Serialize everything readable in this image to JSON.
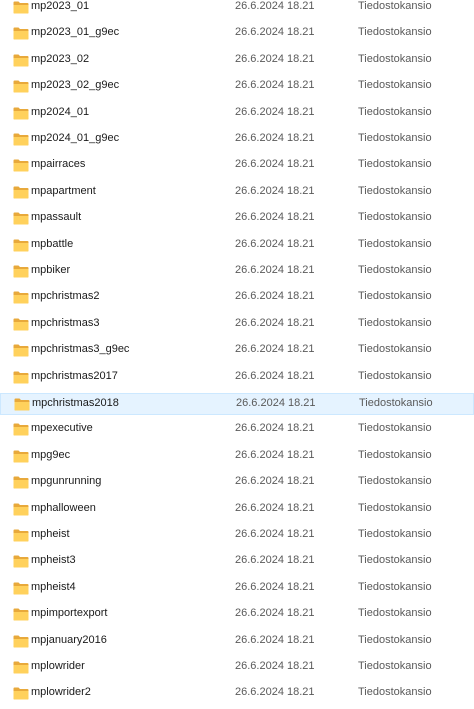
{
  "icons": {
    "folder": "folder-icon"
  },
  "colors": {
    "folder_back": "#e8a93b",
    "folder_front": "#ffd15c",
    "selection_bg": "#e5f3ff",
    "selection_border": "#cce8ff"
  },
  "files": [
    {
      "name": "mp2023_01",
      "modified": "26.6.2024 18.21",
      "type": "Tiedostokansio"
    },
    {
      "name": "mp2023_01_g9ec",
      "modified": "26.6.2024 18.21",
      "type": "Tiedostokansio"
    },
    {
      "name": "mp2023_02",
      "modified": "26.6.2024 18.21",
      "type": "Tiedostokansio"
    },
    {
      "name": "mp2023_02_g9ec",
      "modified": "26.6.2024 18.21",
      "type": "Tiedostokansio"
    },
    {
      "name": "mp2024_01",
      "modified": "26.6.2024 18.21",
      "type": "Tiedostokansio"
    },
    {
      "name": "mp2024_01_g9ec",
      "modified": "26.6.2024 18.21",
      "type": "Tiedostokansio"
    },
    {
      "name": "mpairraces",
      "modified": "26.6.2024 18.21",
      "type": "Tiedostokansio"
    },
    {
      "name": "mpapartment",
      "modified": "26.6.2024 18.21",
      "type": "Tiedostokansio"
    },
    {
      "name": "mpassault",
      "modified": "26.6.2024 18.21",
      "type": "Tiedostokansio"
    },
    {
      "name": "mpbattle",
      "modified": "26.6.2024 18.21",
      "type": "Tiedostokansio"
    },
    {
      "name": "mpbiker",
      "modified": "26.6.2024 18.21",
      "type": "Tiedostokansio"
    },
    {
      "name": "mpchristmas2",
      "modified": "26.6.2024 18.21",
      "type": "Tiedostokansio"
    },
    {
      "name": "mpchristmas3",
      "modified": "26.6.2024 18.21",
      "type": "Tiedostokansio"
    },
    {
      "name": "mpchristmas3_g9ec",
      "modified": "26.6.2024 18.21",
      "type": "Tiedostokansio"
    },
    {
      "name": "mpchristmas2017",
      "modified": "26.6.2024 18.21",
      "type": "Tiedostokansio"
    },
    {
      "name": "mpchristmas2018",
      "modified": "26.6.2024 18.21",
      "type": "Tiedostokansio",
      "selected": true
    },
    {
      "name": "mpexecutive",
      "modified": "26.6.2024 18.21",
      "type": "Tiedostokansio"
    },
    {
      "name": "mpg9ec",
      "modified": "26.6.2024 18.21",
      "type": "Tiedostokansio"
    },
    {
      "name": "mpgunrunning",
      "modified": "26.6.2024 18.21",
      "type": "Tiedostokansio"
    },
    {
      "name": "mphalloween",
      "modified": "26.6.2024 18.21",
      "type": "Tiedostokansio"
    },
    {
      "name": "mpheist",
      "modified": "26.6.2024 18.21",
      "type": "Tiedostokansio"
    },
    {
      "name": "mpheist3",
      "modified": "26.6.2024 18.21",
      "type": "Tiedostokansio"
    },
    {
      "name": "mpheist4",
      "modified": "26.6.2024 18.21",
      "type": "Tiedostokansio"
    },
    {
      "name": "mpimportexport",
      "modified": "26.6.2024 18.21",
      "type": "Tiedostokansio"
    },
    {
      "name": "mpjanuary2016",
      "modified": "26.6.2024 18.21",
      "type": "Tiedostokansio"
    },
    {
      "name": "mplowrider",
      "modified": "26.6.2024 18.21",
      "type": "Tiedostokansio"
    },
    {
      "name": "mplowrider2",
      "modified": "26.6.2024 18.21",
      "type": "Tiedostokansio"
    }
  ]
}
